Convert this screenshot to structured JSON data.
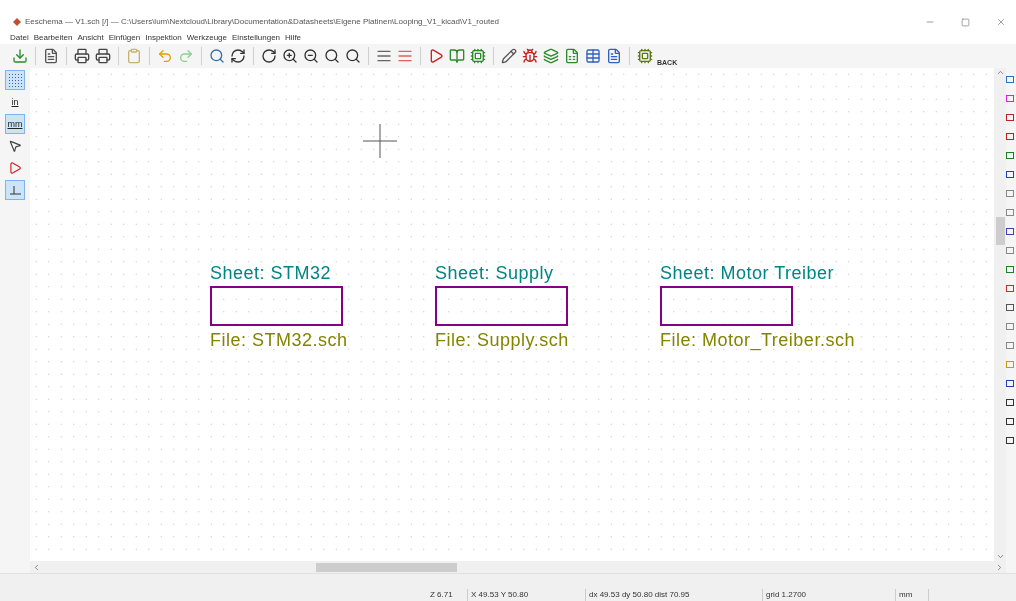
{
  "window": {
    "title": "Eeschema — V1.sch [/] — C:\\Users\\lum\\Nextcloud\\Library\\Documentation&Datasheets\\Eigene Platinen\\Looping_V1_kicad\\V1_routed"
  },
  "menu": [
    "Datei",
    "Bearbeiten",
    "Ansicht",
    "Einfügen",
    "Inspektion",
    "Werkzeuge",
    "Einstellungen",
    "Hilfe"
  ],
  "left_toolbar": [
    {
      "kind": "grid",
      "selected": true
    },
    {
      "kind": "units",
      "label": "in",
      "selected": false
    },
    {
      "kind": "units",
      "label": "mm",
      "selected": true
    },
    {
      "kind": "cursor",
      "selected": false
    },
    {
      "kind": "pins",
      "selected": false
    },
    {
      "kind": "angle",
      "selected": true
    }
  ],
  "toolbar_back_label": "BACK",
  "sheets": [
    {
      "name": "Sheet: STM32",
      "file": "File: STM32.sch"
    },
    {
      "name": "Sheet: Supply",
      "file": "File: Supply.sch"
    },
    {
      "name": "Sheet: Motor Treiber",
      "file": "File: Motor_Treiber.sch"
    }
  ],
  "status_bar": [
    "Z 6.71",
    "X 49.53  Y 50.80",
    "dx 49.53  dy 50.80  dist 70.95",
    "grid 1.2700",
    "mm"
  ]
}
